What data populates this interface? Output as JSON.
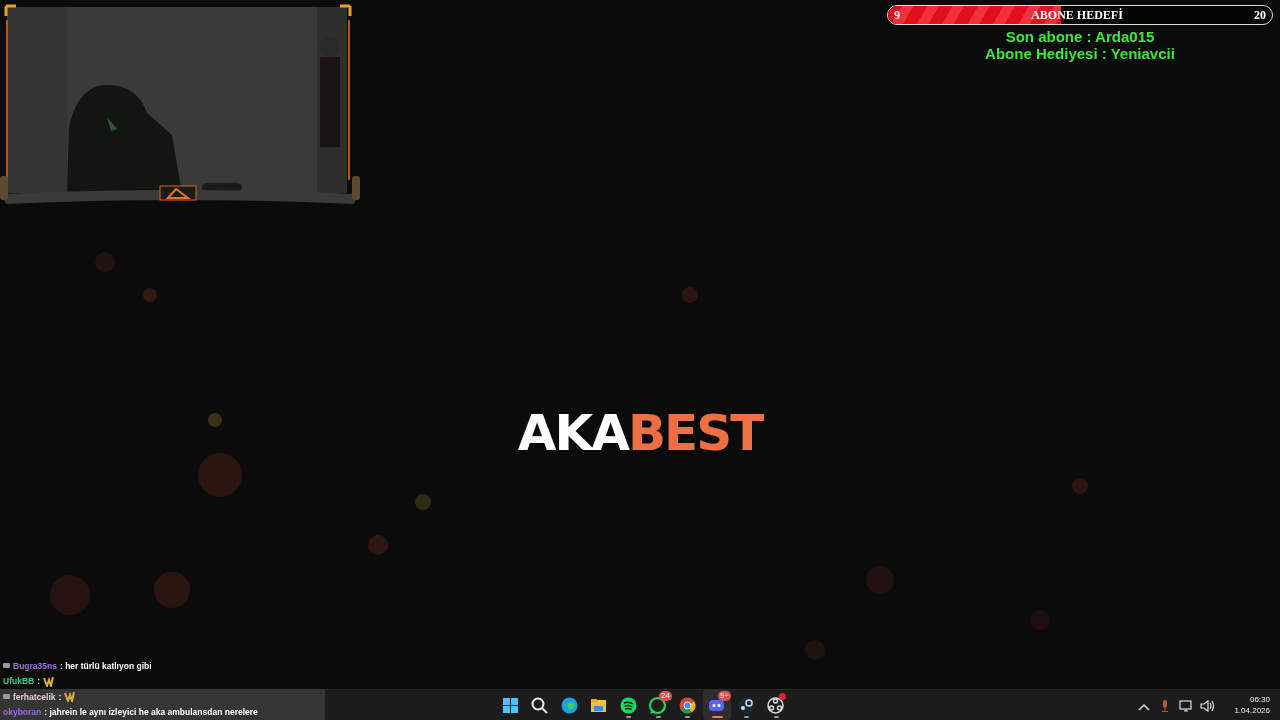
{
  "goal": {
    "start": "9",
    "title": "ABONE HEDEFİ",
    "end": "20",
    "level": 0.45
  },
  "recent": [
    {
      "text": "Son abone : Arda015"
    },
    {
      "text": "Abone Hediyesi : Yeniavcii"
    }
  ],
  "logo": {
    "first": "AKA",
    "second": "BEST"
  },
  "chat": [
    {
      "kind": "text",
      "user": "Bugra35ns",
      "color": "#a66fe0",
      "badge": true,
      "highlighted": false,
      "text": ": her türlü katlıyon gibi"
    },
    {
      "kind": "emote",
      "user": "UfukBB",
      "color": "#3fc88a",
      "badge": false,
      "highlighted": false,
      "text": ":"
    },
    {
      "kind": "emote",
      "user": "ferhatcelik",
      "color": "#e8c8d8",
      "badge": true,
      "highlighted": true,
      "text": ":"
    },
    {
      "kind": "text",
      "user": "okyboran",
      "color": "#9a6ae8",
      "badge": false,
      "highlighted": true,
      "text": ": jahrein le aynı izleyici he aka ambulansdan nerelere"
    }
  ],
  "taskbar": {
    "apps": [
      {
        "kind": "start",
        "running": false,
        "active": false
      },
      {
        "kind": "search",
        "running": false,
        "active": false
      },
      {
        "kind": "edge",
        "running": false,
        "active": false
      },
      {
        "kind": "files",
        "running": false,
        "active": false
      },
      {
        "kind": "spotify",
        "running": true,
        "active": false
      },
      {
        "kind": "whatsapp",
        "running": true,
        "active": false,
        "badge": "24"
      },
      {
        "kind": "chrome",
        "running": true,
        "active": false
      },
      {
        "kind": "discord",
        "running": true,
        "active": true,
        "badge": "9+"
      },
      {
        "kind": "steam",
        "running": true,
        "active": false
      },
      {
        "kind": "obs",
        "running": true,
        "active": false,
        "alert": true
      }
    ],
    "tray": [
      {
        "kind": "chevron"
      },
      {
        "kind": "mic"
      },
      {
        "kind": "network"
      },
      {
        "kind": "volume"
      }
    ],
    "time": "06:30",
    "date": "1.04.2026"
  }
}
